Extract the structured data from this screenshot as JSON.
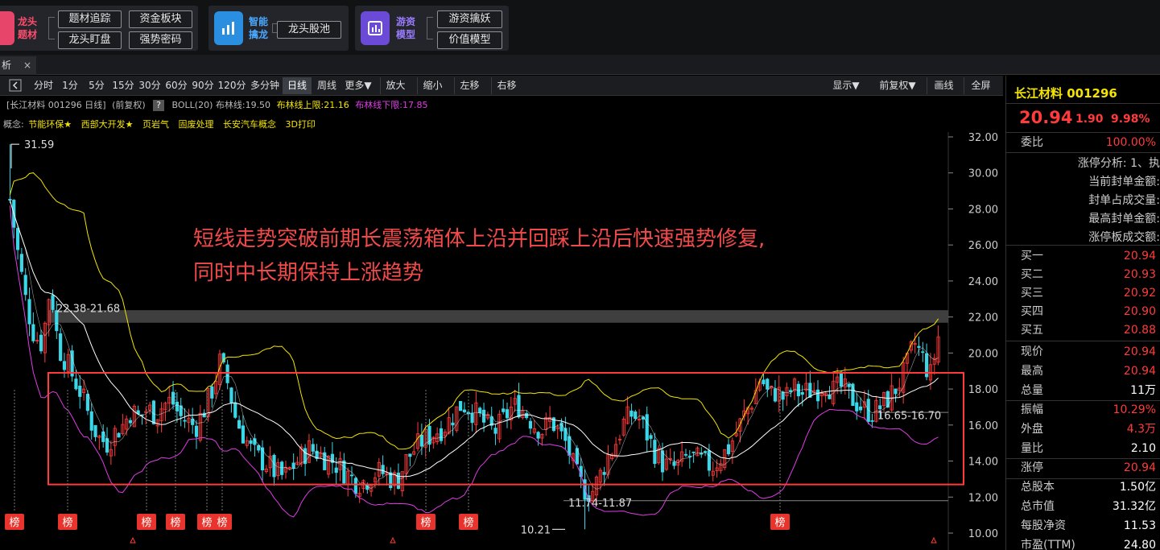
{
  "modules": [
    {
      "title_line1": "龙头",
      "title_line2": "题材",
      "buttons": [
        "题材追踪",
        "资金板块",
        "龙头盯盘",
        "强势密码"
      ]
    },
    {
      "title_line1": "智能",
      "title_line2": "擒龙",
      "buttons": [
        "龙头股池"
      ]
    },
    {
      "title_line1": "游资",
      "title_line2": "模型",
      "buttons": [
        "游资擒妖",
        "价值模型"
      ]
    }
  ],
  "tab": {
    "label": "析",
    "close": "×"
  },
  "toolbar": {
    "periods": [
      "分时",
      "1分",
      "5分",
      "15分",
      "30分",
      "60分",
      "90分",
      "120分",
      "多分钟",
      "日线",
      "周线",
      "更多▼"
    ],
    "actions": [
      "放大",
      "缩小",
      "左移",
      "右移"
    ],
    "right": [
      "显示▼",
      "前复权▼",
      "画线",
      "全屏"
    ],
    "active": "日线"
  },
  "header": {
    "stock": "[长江材料 001296 日线]",
    "adj": "(前复权)",
    "help": "?",
    "boll": "BOLL(20) 布林线:19.50",
    "boll_up": "布林线上限:21.16",
    "boll_low": "布林线下限:17.85"
  },
  "concepts": {
    "prefix": "概念:",
    "items": [
      "节能环保★",
      "西部大开发★",
      "页岩气",
      "固废处理",
      "长安汽车概念",
      "3D打印"
    ]
  },
  "annotation": {
    "line1": "短线走势突破前期长震荡箱体上沿并回踩上沿后快速强势修复,",
    "line2": "同时中长期保持上涨趋势"
  },
  "chart_data": {
    "type": "candlestick",
    "title": "长江材料 001296 日线",
    "ylim": [
      10.0,
      32.0
    ],
    "yticks": [
      "32.00",
      "30.00",
      "28.00",
      "26.00",
      "24.00",
      "22.00",
      "20.00",
      "18.00",
      "16.00",
      "14.00",
      "12.00",
      "10.00"
    ],
    "labels": {
      "high": "31.59",
      "resistance": "22.38-21.68",
      "support": "11.74-11.87",
      "low": "10.21",
      "recent": "16.65-16.70"
    },
    "resistance_band": [
      21.68,
      22.38
    ],
    "support_line": 11.8,
    "box": {
      "y_top": 18.9,
      "y_bottom": 12.7
    },
    "bang_label": "榜",
    "close_path": [
      28.5,
      25.5,
      22.8,
      21.0,
      20.5,
      23.8,
      20.3,
      19.5,
      18.5,
      17.6,
      16.2,
      15.3,
      15.0,
      15.6,
      16.0,
      16.8,
      16.4,
      16.9,
      16.6,
      17.1,
      17.4,
      16.5,
      16.2,
      15.9,
      16.8,
      17.9,
      19.5,
      18.3,
      16.3,
      15.4,
      14.5,
      14.1,
      13.8,
      13.3,
      13.1,
      13.7,
      14.2,
      14.7,
      14.5,
      14.2,
      14.0,
      13.6,
      13.2,
      12.8,
      12.9,
      13.3,
      13.4,
      13.1,
      12.9,
      14.0,
      14.6,
      15.1,
      15.4,
      15.7,
      16.0,
      16.6,
      17.2,
      16.9,
      16.5,
      16.0,
      15.6,
      16.2,
      16.9,
      17.1,
      16.6,
      16.0,
      15.7,
      16.3,
      15.6,
      14.9,
      13.4,
      12.5,
      12.2,
      13.1,
      14.2,
      15.0,
      16.1,
      16.6,
      16.3,
      15.4,
      14.4,
      13.8,
      13.6,
      13.8,
      14.3,
      14.1,
      13.9,
      13.7,
      14.2,
      14.7,
      15.6,
      16.6,
      17.4,
      18.7,
      17.6,
      17.9,
      17.4,
      18.1,
      17.7,
      17.9,
      18.0,
      18.4,
      17.9,
      18.1,
      17.6,
      17.2,
      16.8,
      16.7,
      17.1,
      17.6,
      18.2,
      19.1,
      20.6,
      19.8,
      18.7,
      20.9
    ]
  },
  "quote": {
    "name": "长江材料 001296",
    "price": "20.94",
    "change": "1.90",
    "pct": "9.98%",
    "weibi_label": "委比",
    "weibi": "100.00%",
    "limit_rows": [
      "涨停分析: 1、执",
      "当前封单金额:",
      "封单占成交量:",
      "最高封单金额:",
      "涨停板成交额:"
    ],
    "bids": [
      [
        "买一",
        "20.94"
      ],
      [
        "买二",
        "20.93"
      ],
      [
        "买三",
        "20.92"
      ],
      [
        "买四",
        "20.90"
      ],
      [
        "买五",
        "20.88"
      ]
    ],
    "stats1": [
      [
        "现价",
        "20.94",
        "red"
      ],
      [
        "最高",
        "20.94",
        "red"
      ],
      [
        "总量",
        "11万",
        "white"
      ]
    ],
    "stats2": [
      [
        "振幅",
        "10.29%",
        "red"
      ],
      [
        "外盘",
        "4.3万",
        "red"
      ],
      [
        "量比",
        "2.10",
        "white"
      ]
    ],
    "stats3": [
      [
        "涨停",
        "20.94",
        "red"
      ]
    ],
    "stats4": [
      [
        "总股本",
        "1.50亿"
      ],
      [
        "总市值",
        "31.32亿"
      ],
      [
        "每股净资",
        "11.53"
      ],
      [
        "市盈(TTM)",
        "24.80"
      ]
    ]
  }
}
